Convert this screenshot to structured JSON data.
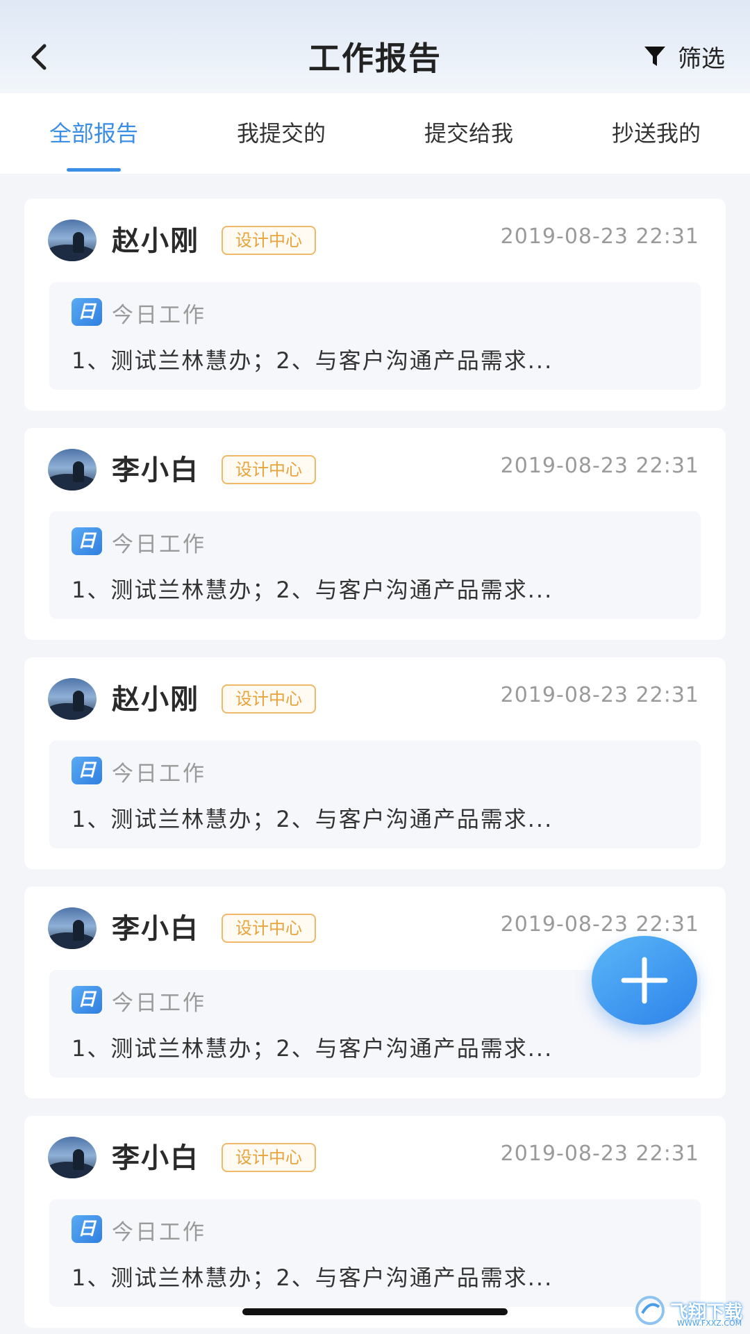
{
  "header": {
    "title": "工作报告",
    "filter_label": "筛选"
  },
  "tabs": [
    {
      "label": "全部报告",
      "active": true
    },
    {
      "label": "我提交的",
      "active": false
    },
    {
      "label": "提交给我",
      "active": false
    },
    {
      "label": "抄送我的",
      "active": false
    }
  ],
  "reports": [
    {
      "name": "赵小刚",
      "dept": "设计中心",
      "time": "2019-08-23 22:31",
      "type_icon": "日",
      "type_label": "今日工作",
      "summary": "1、测试兰林慧办；2、与客户沟通产品需求..."
    },
    {
      "name": "李小白",
      "dept": "设计中心",
      "time": "2019-08-23 22:31",
      "type_icon": "日",
      "type_label": "今日工作",
      "summary": "1、测试兰林慧办；2、与客户沟通产品需求..."
    },
    {
      "name": "赵小刚",
      "dept": "设计中心",
      "time": "2019-08-23 22:31",
      "type_icon": "日",
      "type_label": "今日工作",
      "summary": "1、测试兰林慧办；2、与客户沟通产品需求..."
    },
    {
      "name": "李小白",
      "dept": "设计中心",
      "time": "2019-08-23 22:31",
      "type_icon": "日",
      "type_label": "今日工作",
      "summary": "1、测试兰林慧办；2、与客户沟通产品需求..."
    },
    {
      "name": "李小白",
      "dept": "设计中心",
      "time": "2019-08-23 22:31",
      "type_icon": "日",
      "type_label": "今日工作",
      "summary": "1、测试兰林慧办；2、与客户沟通产品需求..."
    }
  ],
  "watermark": {
    "text": "飞翔下载",
    "sub": "WWW.FXXZ.COM"
  },
  "icons": {
    "back": "back-arrow-icon",
    "filter": "funnel-icon",
    "add": "plus-icon"
  },
  "colors": {
    "accent": "#3a8ee6",
    "badge": "#e8a33c"
  }
}
